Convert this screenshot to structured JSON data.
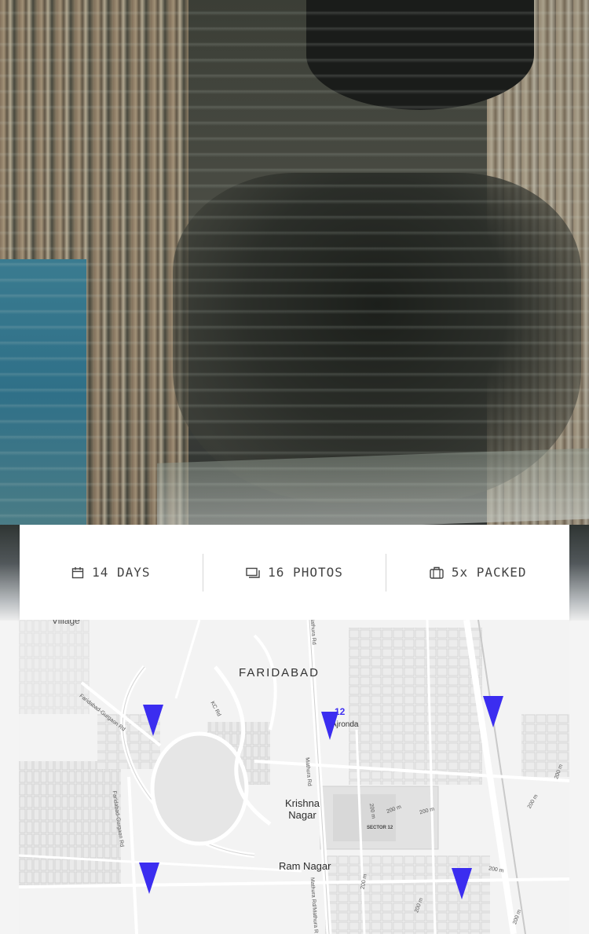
{
  "hero": {
    "image_description_icon": "water-reflection-photo"
  },
  "stats": {
    "days": {
      "icon": "calendar-icon",
      "label": "14 DAYS"
    },
    "photos": {
      "icon": "photos-icon",
      "label": "16 PHOTOS"
    },
    "packed": {
      "icon": "suitcase-icon",
      "label": "5x PACKED"
    }
  },
  "map": {
    "city_label": "FARIDABAD",
    "krishna_nagar": "Krishna Nagar",
    "ram_nagar": "Ram Nagar",
    "village": "Village",
    "sector": "SECTOR 12",
    "jondi": "Ajronda",
    "pin_badge": "12",
    "roads": {
      "mathura_rd": "Mathura Rd",
      "kc_rd": "KC Rd",
      "faridabad_gurgaon_rd": "Faridabad-Gurgaon Rd",
      "faridabad_gurgaon_rd_2": "Faridabad-Gurgaon Rd",
      "mathura_rd_2": "Mathura Rd/Mathura R",
      "distance_200m": "200 m"
    },
    "colors": {
      "pin": "#3b2df0",
      "badge": "#3f2ff2"
    }
  }
}
